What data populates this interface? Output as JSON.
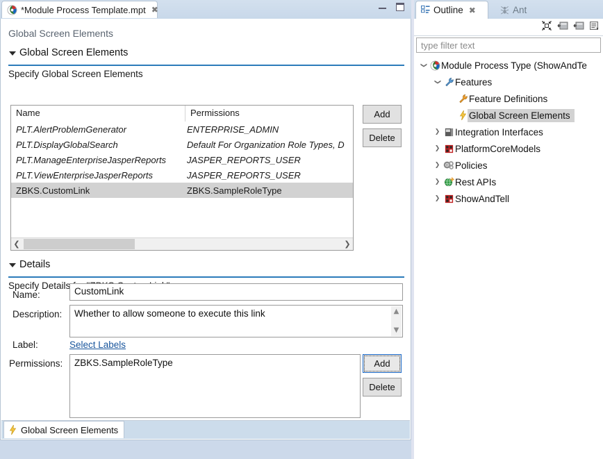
{
  "editor": {
    "tab": {
      "title": "*Module Process Template.mpt",
      "icon": "module-process-icon",
      "close_icon": "close-icon"
    },
    "window_controls": {
      "minimize": "minimize-icon",
      "maximize": "maximize-icon"
    },
    "form_title": "Global Screen Elements",
    "sections": [
      {
        "id": "global-screen-elements",
        "label": "Global Screen Elements",
        "description": "Specify Global Screen Elements",
        "expanded": true
      },
      {
        "id": "details",
        "label": "Details",
        "description": "Specify Details for \"ZBKS.CustomLink\".",
        "expanded": true
      }
    ],
    "table": {
      "columns": [
        "Name",
        "Permissions"
      ],
      "rows": [
        {
          "name": "PLT.AlertProblemGenerator",
          "permissions": "ENTERPRISE_ADMIN",
          "selected": false
        },
        {
          "name": "PLT.DisplayGlobalSearch",
          "permissions": "Default For Organization Role Types, D",
          "selected": false
        },
        {
          "name": "PLT.ManageEnterpriseJasperReports",
          "permissions": "JASPER_REPORTS_USER",
          "selected": false
        },
        {
          "name": "PLT.ViewEnterpriseJasperReports",
          "permissions": "JASPER_REPORTS_USER",
          "selected": false
        },
        {
          "name": "ZBKS.CustomLink",
          "permissions": "ZBKS.SampleRoleType",
          "selected": true
        }
      ],
      "scroll_left_icon": "chevron-left-icon",
      "scroll_right_icon": "chevron-right-icon",
      "add_label": "Add",
      "delete_label": "Delete"
    },
    "details": {
      "name_label": "Name:",
      "name_value": "CustomLink",
      "description_label": "Description:",
      "description_value": "Whether to allow someone to execute this link",
      "label_label": "Label:",
      "label_link": "Select Labels",
      "permissions_label": "Permissions:",
      "permissions_value": "ZBKS.SampleRoleType",
      "add_label": "Add",
      "delete_label": "Delete",
      "scroll_up_icon": "chevron-up-icon",
      "scroll_down_icon": "chevron-down-icon"
    },
    "bottom_tab": {
      "label": "Global Screen Elements",
      "icon": "lightning-bolt-icon"
    }
  },
  "outline": {
    "tabs": [
      {
        "label": "Outline",
        "icon": "outline-icon",
        "active": true,
        "close_icon": "close-icon"
      },
      {
        "label": "Ant",
        "icon": "ant-icon",
        "active": false
      }
    ],
    "toolbar": [
      {
        "name": "collapse-all-icon"
      },
      {
        "name": "link-with-editor-icon"
      },
      {
        "name": "link-with-editor-alt-icon"
      },
      {
        "name": "view-menu-icon"
      }
    ],
    "filter": {
      "placeholder": "type filter text",
      "value": ""
    },
    "tree": [
      {
        "label": "Module Process Type (ShowAndTe",
        "icon": "module-process-icon",
        "arrow": "expanded",
        "indent": 0,
        "selected": false
      },
      {
        "label": "Features",
        "icon": "blue-wrench-icon",
        "arrow": "expanded",
        "indent": 1,
        "selected": false
      },
      {
        "label": "Feature Definitions",
        "icon": "orange-wrench-icon",
        "arrow": "none",
        "indent": 2,
        "selected": false
      },
      {
        "label": "Global Screen Elements",
        "icon": "lightning-bolt-icon",
        "arrow": "none",
        "indent": 2,
        "selected": true
      },
      {
        "label": "Integration Interfaces",
        "icon": "integration-icon",
        "arrow": "collapsed",
        "indent": 1,
        "selected": false
      },
      {
        "label": "PlatformCoreModels",
        "icon": "model-icon",
        "arrow": "collapsed",
        "indent": 1,
        "selected": false
      },
      {
        "label": "Policies",
        "icon": "policies-gear-icon",
        "arrow": "collapsed",
        "indent": 1,
        "selected": false
      },
      {
        "label": "Rest APIs",
        "icon": "rest-api-globe-icon",
        "arrow": "collapsed",
        "indent": 1,
        "selected": false
      },
      {
        "label": "ShowAndTell",
        "icon": "model-icon",
        "arrow": "collapsed",
        "indent": 1,
        "selected": false
      }
    ]
  },
  "colors": {
    "accent_rule": "#2b7bba",
    "link": "#18559c",
    "selection": "#d2d2d2",
    "tab_bar": "#c8d8ea",
    "window_bg": "#dfe3f0"
  }
}
